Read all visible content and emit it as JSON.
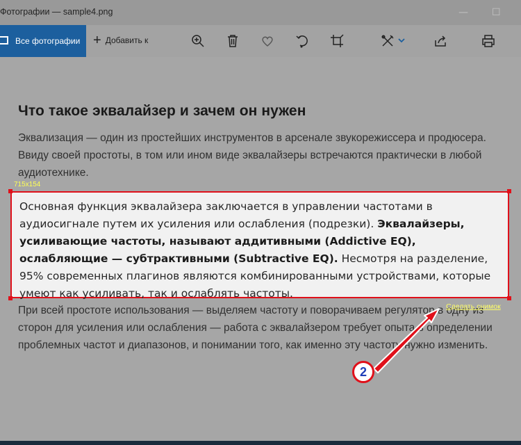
{
  "window": {
    "title": "Фотографии — sample4.png",
    "minimize_glyph": "—",
    "maximize_glyph": "☐"
  },
  "toolbar": {
    "all_photos_label": "Все фотографии",
    "add_to_label": "Добавить к",
    "icons": [
      "zoom-in-icon",
      "delete-icon",
      "favorite-icon",
      "rotate-icon",
      "crop-icon",
      "edit-icon",
      "share-icon",
      "print-icon"
    ]
  },
  "document": {
    "heading": "Что такое эквалайзер и зачем он нужен",
    "paragraph1": "Эквализация — один из простейших инструментов в арсенале звукорежиссера и продюсера. Ввиду своей простоты, в том или ином виде эквалайзеры встречаются практически в любой аудиотехнике.",
    "selected_part1": "Основная функция эквалайзера заключается в управлении частотами в аудиосигнале путем их усиления или ослабления (подрезки). ",
    "selected_bold": "Эквалайзеры, усиливающие частоты, называют аддитивными (Addictive EQ), ослабляющие — субтрактивными (Subtractive EQ).",
    "selected_part2": " Несмотря на разделение, 95% современных плагинов являются комбинированными устройствами, которые умеют как усиливать, так и ослаблять частоты.",
    "paragraph3": "При всей простоте использования — выделяем частоту и поворачиваем регулятор в одну из сторон для усиления или ослабления — работа с эквалайзером требует опыта в определении проблемных частот и диапазонов, и понимании того, как именно эту частоту нужно изменить."
  },
  "capture": {
    "size_label": "715x154",
    "snapshot_link": "Сделать снимок",
    "step_badge": "2"
  },
  "colors": {
    "accent_blue": "#1c5f9e",
    "selection_red": "#e0101a",
    "link_yellow": "#ffff66",
    "badge_text": "#1f3fb8"
  }
}
